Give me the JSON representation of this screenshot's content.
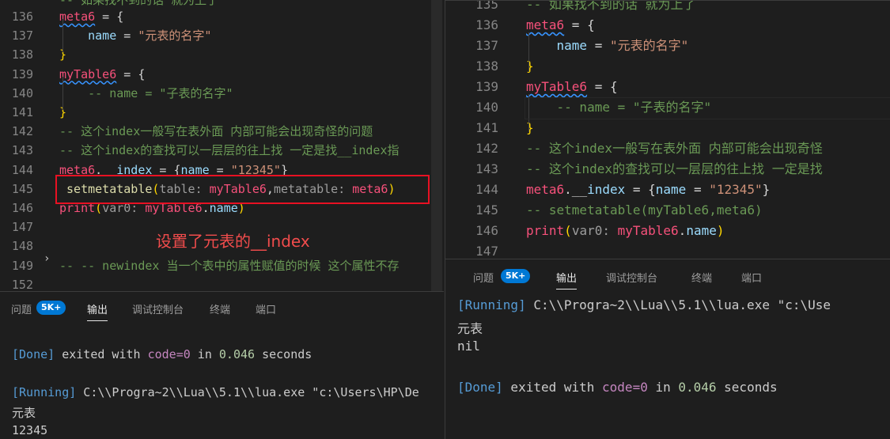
{
  "left": {
    "lines": [
      {
        "num": "136",
        "parts": [
          {
            "t": "meta6",
            "c": "k squig"
          },
          {
            "t": " = {",
            "c": ""
          }
        ]
      },
      {
        "num": "137",
        "parts": [
          {
            "t": "    name",
            "c": "p"
          },
          {
            "t": " = ",
            "c": ""
          },
          {
            "t": "\"元表的名字\"",
            "c": "s"
          }
        ]
      },
      {
        "num": "138",
        "parts": [
          {
            "t": "}",
            "c": "pb"
          }
        ]
      },
      {
        "num": "139",
        "parts": [
          {
            "t": "myTable6",
            "c": "k squig"
          },
          {
            "t": " = {",
            "c": ""
          }
        ]
      },
      {
        "num": "140",
        "parts": [
          {
            "t": "    -- name = \"子表的名字\"",
            "c": "c"
          }
        ]
      },
      {
        "num": "141",
        "parts": [
          {
            "t": "}",
            "c": "pb"
          }
        ]
      },
      {
        "num": "142",
        "parts": [
          {
            "t": "-- 这个index一般写在表外面 内部可能会出现奇怪的问题",
            "c": "c"
          }
        ]
      },
      {
        "num": "143",
        "parts": [
          {
            "t": "-- 这个index的查找可以一层层的往上找 一定是找__index指",
            "c": "c"
          }
        ]
      },
      {
        "num": "144",
        "parts": [
          {
            "t": "meta6",
            "c": "k"
          },
          {
            "t": ".  ",
            "c": ""
          },
          {
            "t": "index",
            "c": "p"
          },
          {
            "t": " = {",
            "c": ""
          },
          {
            "t": "name",
            "c": "p"
          },
          {
            "t": " = ",
            "c": ""
          },
          {
            "t": "\"12345\"",
            "c": "s"
          },
          {
            "t": "}",
            "c": ""
          }
        ]
      },
      {
        "num": "145",
        "parts": [
          {
            "t": " setmetatable",
            "c": "f"
          },
          {
            "t": "(",
            "c": "pb"
          },
          {
            "t": "table: ",
            "c": "h"
          },
          {
            "t": "myTable6",
            "c": "k"
          },
          {
            "t": ",",
            "c": ""
          },
          {
            "t": "metatable: ",
            "c": "h"
          },
          {
            "t": "meta6",
            "c": "k"
          },
          {
            "t": ")",
            "c": "pb"
          }
        ]
      },
      {
        "num": "146",
        "parts": [
          {
            "t": "print",
            "c": "k"
          },
          {
            "t": "(",
            "c": "pb"
          },
          {
            "t": "var0: ",
            "c": "h"
          },
          {
            "t": "myTable6",
            "c": "k"
          },
          {
            "t": ".",
            "c": ""
          },
          {
            "t": "name",
            "c": "p"
          },
          {
            "t": ")",
            "c": "pb"
          }
        ]
      },
      {
        "num": "147",
        "parts": []
      },
      {
        "num": "148",
        "parts": []
      },
      {
        "num": "149",
        "parts": [
          {
            "t": "-- -- newindex 当一个表中的属性赋值的时候 这个属性不存",
            "c": "c"
          }
        ]
      },
      {
        "num": "152",
        "parts": []
      }
    ],
    "top_partial": "-- 如果找不到的话 就为上了",
    "annotation": "设置了元表的__index",
    "panel": {
      "tabs": [
        "问题",
        "输出",
        "调试控制台",
        "终端",
        "端口"
      ],
      "badge": "5K+",
      "output": [
        {
          "parts": [
            {
              "t": "[Done]",
              "c": "blue"
            },
            {
              "t": " exited with ",
              "c": ""
            },
            {
              "t": "code=0",
              "c": "purple"
            },
            {
              "t": " in ",
              "c": ""
            },
            {
              "t": "0.046",
              "c": "numc"
            },
            {
              "t": " seconds",
              "c": ""
            }
          ]
        },
        {
          "parts": []
        },
        {
          "parts": [
            {
              "t": "[Running]",
              "c": "blue"
            },
            {
              "t": " C:\\\\Progra~2\\\\Lua\\\\5.1\\\\lua.exe \"c:\\Users\\HP\\De",
              "c": ""
            }
          ]
        },
        {
          "parts": [
            {
              "t": "元表",
              "c": ""
            }
          ]
        },
        {
          "parts": [
            {
              "t": "12345",
              "c": ""
            }
          ]
        }
      ]
    }
  },
  "right": {
    "lines": [
      {
        "num": "135",
        "parts": [
          {
            "t": "-- 如果找不到的话 就为上了",
            "c": "c"
          }
        ]
      },
      {
        "num": "136",
        "parts": [
          {
            "t": "meta6",
            "c": "k squig"
          },
          {
            "t": " = {",
            "c": ""
          }
        ]
      },
      {
        "num": "137",
        "parts": [
          {
            "t": "    name",
            "c": "p"
          },
          {
            "t": " = ",
            "c": ""
          },
          {
            "t": "\"元表的名字\"",
            "c": "s"
          }
        ]
      },
      {
        "num": "138",
        "parts": [
          {
            "t": "}",
            "c": "pb"
          }
        ]
      },
      {
        "num": "139",
        "parts": [
          {
            "t": "myTable6",
            "c": "k squig"
          },
          {
            "t": " = {",
            "c": ""
          }
        ]
      },
      {
        "num": "140",
        "parts": [
          {
            "t": "    -- name = \"子表的名字\"",
            "c": "c"
          }
        ]
      },
      {
        "num": "141",
        "parts": [
          {
            "t": "}",
            "c": "pb"
          }
        ]
      },
      {
        "num": "142",
        "parts": [
          {
            "t": "-- 这个index一般写在表外面 内部可能会出现奇怪",
            "c": "c"
          }
        ]
      },
      {
        "num": "143",
        "parts": [
          {
            "t": "-- 这个index的查找可以一层层的往上找 一定是找",
            "c": "c"
          }
        ]
      },
      {
        "num": "144",
        "parts": [
          {
            "t": "meta6",
            "c": "k"
          },
          {
            "t": ".__",
            "c": ""
          },
          {
            "t": "index",
            "c": "p"
          },
          {
            "t": " = {",
            "c": ""
          },
          {
            "t": "name",
            "c": "p"
          },
          {
            "t": " = ",
            "c": ""
          },
          {
            "t": "\"12345\"",
            "c": "s"
          },
          {
            "t": "}",
            "c": ""
          }
        ]
      },
      {
        "num": "145",
        "parts": [
          {
            "t": "-- setmetatable(myTable6,meta6)",
            "c": "c"
          }
        ]
      },
      {
        "num": "146",
        "parts": [
          {
            "t": "print",
            "c": "k"
          },
          {
            "t": "(",
            "c": "pb"
          },
          {
            "t": "var0: ",
            "c": "h"
          },
          {
            "t": "myTable6",
            "c": "k"
          },
          {
            "t": ".",
            "c": ""
          },
          {
            "t": "name",
            "c": "p"
          },
          {
            "t": ")",
            "c": "pb"
          }
        ]
      },
      {
        "num": "147",
        "parts": []
      }
    ],
    "panel": {
      "tabs": [
        "问题",
        "输出",
        "调试控制台",
        "终端",
        "端口"
      ],
      "badge": "5K+",
      "output": [
        {
          "parts": [
            {
              "t": "[Running]",
              "c": "blue"
            },
            {
              "t": " C:\\\\Progra~2\\\\Lua\\\\5.1\\\\lua.exe \"c:\\Use",
              "c": ""
            }
          ]
        },
        {
          "parts": [
            {
              "t": "元表",
              "c": ""
            }
          ]
        },
        {
          "parts": [
            {
              "t": "nil",
              "c": ""
            }
          ]
        },
        {
          "parts": []
        },
        {
          "parts": [
            {
              "t": "[Done]",
              "c": "blue"
            },
            {
              "t": " exited with ",
              "c": ""
            },
            {
              "t": "code=0",
              "c": "purple"
            },
            {
              "t": " in ",
              "c": ""
            },
            {
              "t": "0.046",
              "c": "numc"
            },
            {
              "t": " seconds",
              "c": ""
            }
          ]
        }
      ]
    }
  }
}
